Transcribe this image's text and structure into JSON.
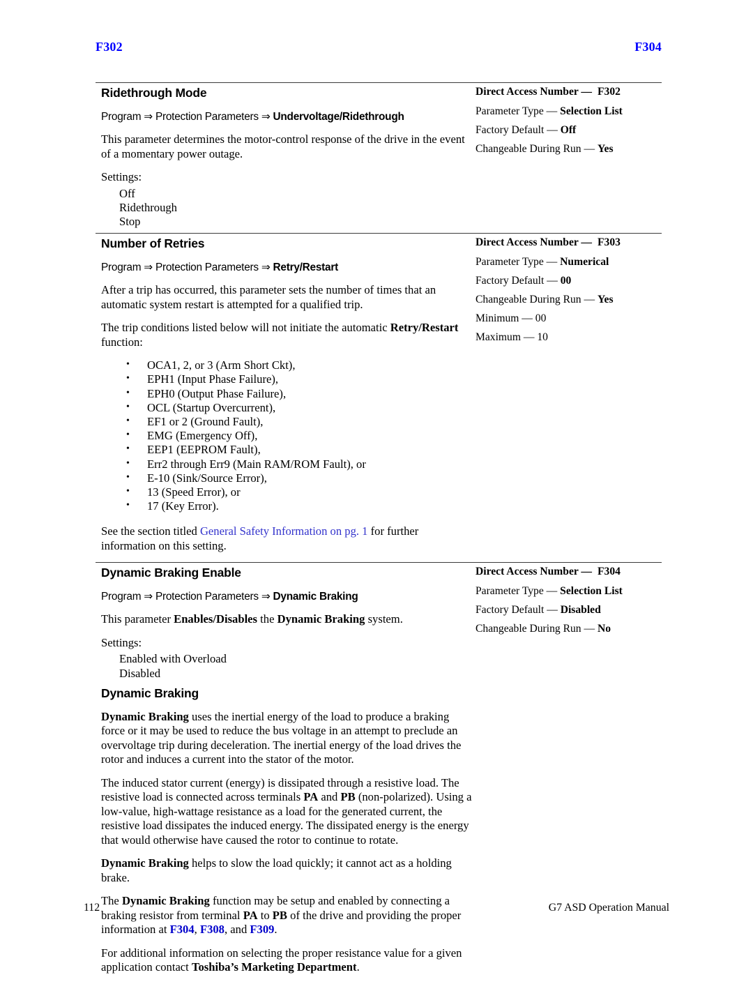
{
  "running_header": {
    "left": "F302",
    "right": "F304"
  },
  "sections": [
    {
      "title": "Ridethrough Mode",
      "breadcrumb": {
        "prefix": "Program ⇒ Protection Parameters ⇒ ",
        "bold": "Undervoltage/Ridethrough"
      },
      "description": "This parameter determines the motor-control response of the drive in the event of a momentary power outage.",
      "settings_label": "Settings:",
      "settings": [
        "Off",
        "Ridethrough",
        "Stop"
      ],
      "attributes": {
        "direct_access_label": "Direct Access Number —",
        "direct_access_value": "F302",
        "parameter_type_label": "Parameter Type —",
        "parameter_type_value": "Selection List",
        "factory_default_label": "Factory Default —",
        "factory_default_value": "Off",
        "changeable_label": "Changeable During Run —",
        "changeable_value": "Yes"
      }
    },
    {
      "title": "Number of Retries",
      "breadcrumb": {
        "prefix": "Program ⇒ Protection Parameters ⇒ ",
        "bold": "Retry/Restart"
      },
      "paragraph1": "After a trip has occurred, this parameter sets the number of times that an automatic system restart is attempted for a qualified trip.",
      "paragraph2_pre": "The trip conditions listed below will not initiate the automatic ",
      "paragraph2_bold": "Retry/Restart",
      "paragraph2_post": " function:",
      "trip_conditions": [
        "OCA1, 2, or 3 (Arm Short Ckt),",
        "EPH1 (Input Phase Failure),",
        "EPH0 (Output Phase Failure),",
        "OCL (Startup Overcurrent),",
        "EF1 or 2 (Ground Fault),",
        "EMG (Emergency Off),",
        "EEP1 (EEPROM Fault),",
        "Err2 through Err9 (Main RAM/ROM Fault), or",
        "E-10 (Sink/Source Error),",
        "13 (Speed Error), or",
        "17 (Key Error)."
      ],
      "see_also_pre": "See the section titled ",
      "see_also_link": "General Safety Information on pg. 1",
      "see_also_post": " for further information on this setting.",
      "attributes": {
        "direct_access_label": "Direct Access Number —",
        "direct_access_value": "F303",
        "parameter_type_label": "Parameter Type —",
        "parameter_type_value": "Numerical",
        "factory_default_label": "Factory Default —",
        "factory_default_value": "00",
        "changeable_label": "Changeable During Run —",
        "changeable_value": "Yes",
        "minimum_label": "Minimum —",
        "minimum_value": "00",
        "maximum_label": "Maximum —",
        "maximum_value": "10"
      }
    },
    {
      "title": "Dynamic Braking Enable",
      "breadcrumb": {
        "prefix": "Program ⇒ Protection Parameters ⇒ ",
        "bold": "Dynamic Braking"
      },
      "description_pre": "This parameter ",
      "description_b1": "Enables/Disables",
      "description_mid": " the ",
      "description_b2": "Dynamic Braking",
      "description_post": " system.",
      "settings_label": "Settings:",
      "settings": [
        "Enabled with Overload",
        "Disabled"
      ],
      "attributes": {
        "direct_access_label": "Direct Access Number —",
        "direct_access_value": "F304",
        "parameter_type_label": "Parameter Type —",
        "parameter_type_value": "Selection List",
        "factory_default_label": "Factory Default —",
        "factory_default_value": "Disabled",
        "changeable_label": "Changeable During Run —",
        "changeable_value": "No"
      }
    }
  ],
  "dynamic_braking": {
    "title": "Dynamic Braking",
    "p1_bold": "Dynamic Braking",
    "p1_rest": " uses the inertial energy of the load to produce a braking force or it may be used to reduce the bus voltage in an attempt to preclude an overvoltage trip during deceleration. The inertial energy of the load drives the rotor and induces a current into the stator of the motor.",
    "p2_a": "The induced stator current (energy) is dissipated through a resistive load. The resistive load is connected across terminals ",
    "p2_b1": "PA",
    "p2_b": " and ",
    "p2_b2": "PB",
    "p2_c": " (non-polarized). Using a low-value, high-wattage resistance as a load for the generated current, the resistive load dissipates the induced energy. The dissipated energy is the energy that would otherwise have caused the rotor to continue to rotate.",
    "p3_bold": "Dynamic Braking",
    "p3_rest": " helps to slow the load quickly; it cannot act as a holding brake.",
    "p4_a": "The ",
    "p4_b1": "Dynamic Braking",
    "p4_b": " function may be setup and enabled by connecting a braking resistor from terminal ",
    "p4_b2": "PA",
    "p4_c": " to ",
    "p4_b3": "PB",
    "p4_d": " of the drive and providing the proper information at ",
    "p4_l1": "F304",
    "p4_sep1": ", ",
    "p4_l2": "F308",
    "p4_sep2": ", and ",
    "p4_l3": "F309",
    "p4_end": ".",
    "p5_a": "For additional information on selecting the proper resistance value for a given application contact ",
    "p5_bold": "Toshiba’s Marketing Department",
    "p5_end": "."
  },
  "footer": {
    "page_number": "112",
    "manual_title": "G7 ASD Operation Manual"
  },
  "colors": {
    "header_blue": "#0000ff",
    "link_blue": "#3333cc",
    "ref_blue": "#0000cc",
    "rule": "#3a3a3a"
  }
}
